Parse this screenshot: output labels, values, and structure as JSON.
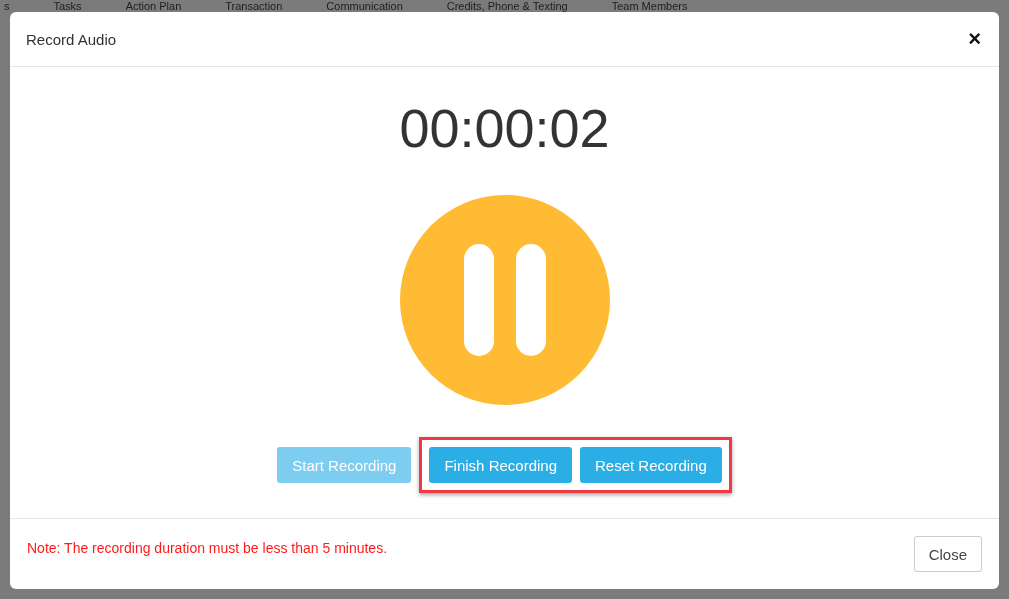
{
  "background_nav": [
    "s",
    "Tasks",
    "Action Plan",
    "Transaction",
    "Communication",
    "Credits, Phone & Texting",
    "Team Members"
  ],
  "dialog": {
    "title": "Record Audio",
    "close_icon": "×",
    "timer": "00:00:02",
    "recording": true,
    "buttons": [
      {
        "label": "Start Recording",
        "disabled": true,
        "highlighted": false
      },
      {
        "label": "Finish Recording",
        "disabled": false,
        "highlighted": true
      },
      {
        "label": "Reset Recording",
        "disabled": false,
        "highlighted": true
      }
    ],
    "note": "Note: The recording duration must be less than 5 minutes.",
    "footer_button": "Close"
  }
}
